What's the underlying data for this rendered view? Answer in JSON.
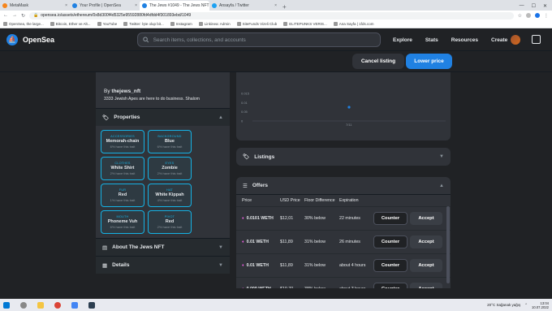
{
  "browser": {
    "tabs": [
      {
        "title": "MetaMask",
        "color": "#f6851b",
        "active": false
      },
      {
        "title": "Your Profile | OpenSea",
        "color": "#2081e2",
        "active": false
      },
      {
        "title": "The Jews #1049 - The Jews NFT",
        "color": "#2081e2",
        "active": true
      },
      {
        "title": "Ansayfa / Twitter",
        "color": "#1da1f2",
        "active": false
      }
    ],
    "url": "opensea.io/assets/ethereum/0x8d300f4d5325e95592880fd4dfdd4f301893ebd/1049",
    "bookmarks": [
      "OpenSea, the large...",
      "Bitcoin, Ether ve Alt...",
      "YouTube",
      "Twitter: İşte olup bit...",
      "Instagram",
      "Linkinea: Admin",
      "SiteFunds Vizeli Club",
      "ELITEPUNKS VERIS...",
      "Ana Sayfa | 1fds.com"
    ]
  },
  "header": {
    "logo_text": "OpenSea",
    "search_placeholder": "Search items, collections, and accounts",
    "nav": [
      "Explore",
      "Stats",
      "Resources",
      "Create"
    ]
  },
  "actions": {
    "cancel_label": "Cancel listing",
    "lower_label": "Lower price"
  },
  "about": {
    "by_prefix": "By",
    "creator": "thejews_nft",
    "description": "3333 Jewish Apes are here to do business. Shalom"
  },
  "properties": {
    "title": "Properties",
    "traits": [
      {
        "type": "ACCESSORIES",
        "value": "Memorah-chain",
        "rarity": "6% have this trait"
      },
      {
        "type": "BACKGROUND",
        "value": "Blue",
        "rarity": "6% have this trait"
      },
      {
        "type": "CLOTHES",
        "value": "White Shirt",
        "rarity": "2% have this trait"
      },
      {
        "type": "EYES",
        "value": "Zombie",
        "rarity": "2% have this trait"
      },
      {
        "type": "FUR",
        "value": "Red",
        "rarity": "1% have this trait"
      },
      {
        "type": "HAT",
        "value": "White Kippah",
        "rarity": "4% have this trait"
      },
      {
        "type": "MOUTH",
        "value": "Phoneme Vuh",
        "rarity": "6% have this trait"
      },
      {
        "type": "PIVOT",
        "value": "Red",
        "rarity": "2% have this trait"
      }
    ]
  },
  "sections": {
    "about_collection": "About The Jews NFT",
    "details": "Details",
    "listings": "Listings",
    "offers": "Offers"
  },
  "chart_data": {
    "type": "scatter",
    "x": [
      "7/11"
    ],
    "values": [
      0.03
    ],
    "yticks": [
      "0.015",
      "0.01",
      "0.05",
      "0"
    ],
    "xlabel": "7/11",
    "ylabel": ""
  },
  "offers": {
    "columns": [
      "Price",
      "USD Price",
      "Floor Difference",
      "Expiration"
    ],
    "rows": [
      {
        "price": "0.0101 WETH",
        "usd": "$12,01",
        "floor": "30% below",
        "expiration": "22 minutes"
      },
      {
        "price": "0.01 WETH",
        "usd": "$11,89",
        "floor": "31% below",
        "expiration": "26 minutes"
      },
      {
        "price": "0.01 WETH",
        "usd": "$11,89",
        "floor": "31% below",
        "expiration": "about 4 hours"
      },
      {
        "price": "0.009 WETH",
        "usd": "$10,70",
        "floor": "38% below",
        "expiration": "about 3 hours"
      }
    ],
    "counter_label": "Counter",
    "accept_label": "Accept"
  },
  "taskbar": {
    "weather": "20°C Sağanak yağış",
    "time": "13:04",
    "date": "10.07.2022"
  }
}
